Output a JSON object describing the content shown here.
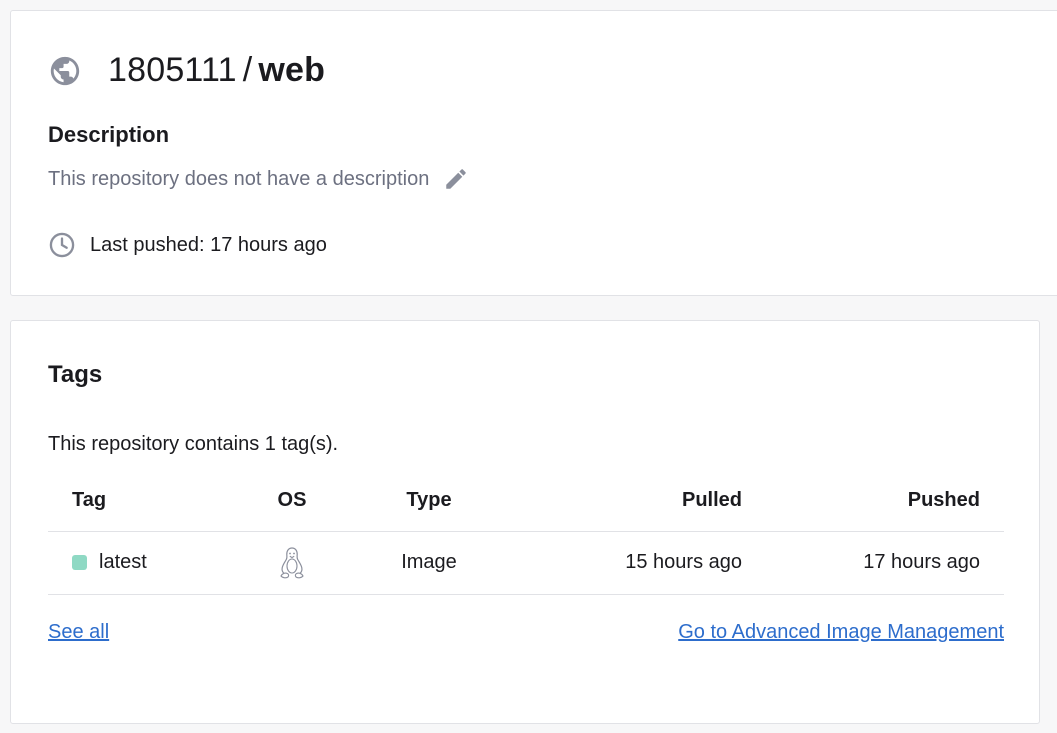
{
  "repo": {
    "namespace": "1805111",
    "separator": "/",
    "name": "web",
    "description_heading": "Description",
    "description_text": "This repository does not have a description",
    "last_pushed": "Last pushed: 17 hours ago"
  },
  "tags_section": {
    "heading": "Tags",
    "count_text": "This repository contains 1 tag(s).",
    "columns": {
      "tag": "Tag",
      "os": "OS",
      "type": "Type",
      "pulled": "Pulled",
      "pushed": "Pushed"
    },
    "rows": [
      {
        "tag": "latest",
        "os_icon": "linux-icon",
        "type": "Image",
        "pulled": "15 hours ago",
        "pushed": "17 hours ago",
        "status_color": "#8fd9c4"
      }
    ],
    "see_all": "See all",
    "advanced": "Go to Advanced Image Management"
  },
  "colors": {
    "link": "#2d6dcc",
    "muted_text": "#6c7080",
    "icon_gray": "#8b8f9c",
    "tag_status": "#8fd9c4"
  },
  "icons": {
    "visibility": "globe-icon",
    "edit": "pencil-icon",
    "pushed": "clock-icon",
    "os": "linux-icon"
  }
}
